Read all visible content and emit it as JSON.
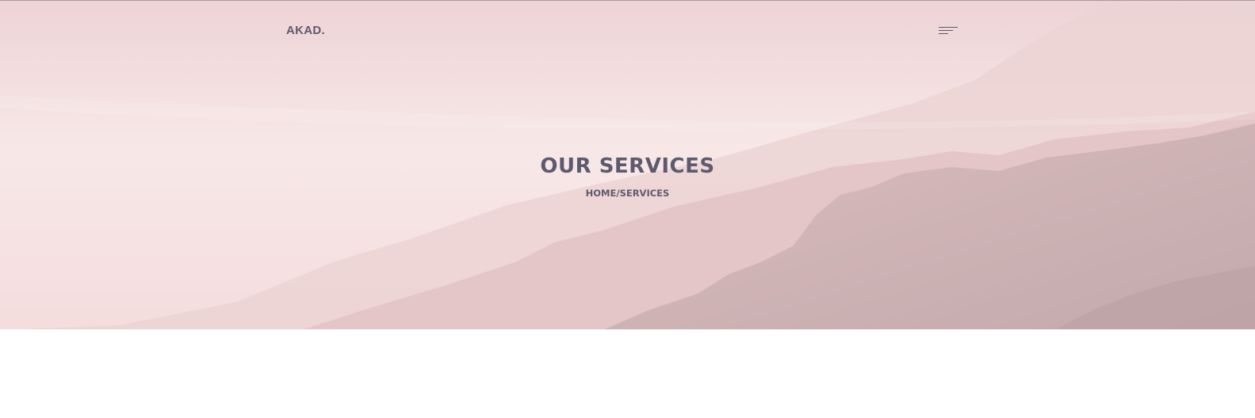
{
  "header": {
    "brand": "AKAD.",
    "menu_icon": "hamburger-menu-icon"
  },
  "hero": {
    "title": "OUR SERVICES",
    "breadcrumb": {
      "home": "HOME",
      "separator": "/",
      "current": "SERVICES"
    }
  },
  "colors": {
    "text": "#5e5a6e",
    "hero_light": "#f7e9e8",
    "hero_pink": "#f3d6d8",
    "mountain_far": "#ecd3d4",
    "mountain_mid": "#e3c4c6",
    "mountain_near": "#d8b9bb",
    "mountain_front": "#c8aaad",
    "page_background": "#ffffff"
  }
}
